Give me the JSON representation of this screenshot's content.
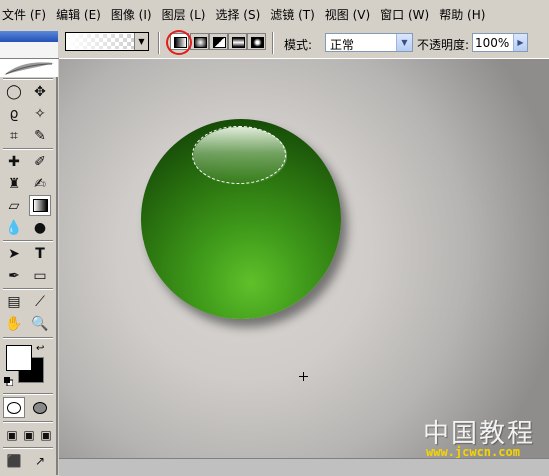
{
  "menu": {
    "items": [
      "文件 (F)",
      "编辑 (E)",
      "图像 (I)",
      "图层 (L)",
      "选择 (S)",
      "滤镜 (T)",
      "视图 (V)",
      "窗口 (W)",
      "帮助 (H)"
    ]
  },
  "options": {
    "gradient_types": [
      "linear-gradient",
      "radial-gradient",
      "angle-gradient",
      "reflected-gradient",
      "diamond-gradient"
    ],
    "mode_label": "模式:",
    "mode_value": "正常",
    "opacity_label": "不透明度:",
    "opacity_value": "100%"
  },
  "colors": {
    "foreground": "#ffffff",
    "background": "#000000",
    "ball_green": "#3f9a1a",
    "highlight_circle": "#e0201a"
  },
  "watermark": {
    "title": "中国教程网",
    "url": "www.jcwcn.com"
  }
}
